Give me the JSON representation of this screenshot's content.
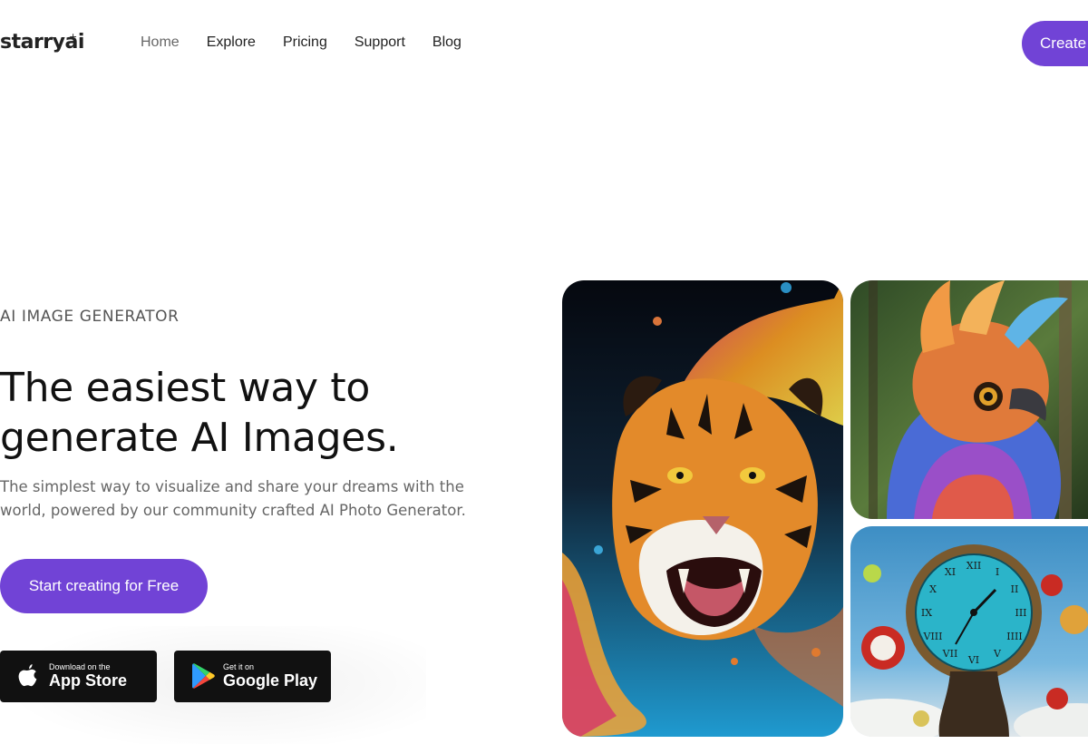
{
  "brand": {
    "logo_text": "starryai",
    "logo_star": "+",
    "accent_color": "#7143d6"
  },
  "nav": {
    "items": [
      {
        "label": "Home",
        "active": true
      },
      {
        "label": "Explore"
      },
      {
        "label": "Pricing"
      },
      {
        "label": "Support"
      },
      {
        "label": "Blog"
      }
    ],
    "create_label": "Create"
  },
  "hero": {
    "eyebrow": "AI IMAGE GENERATOR",
    "headline": "The easiest way to generate AI Images.",
    "subtitle": "The simplest way to visualize and share your dreams with the world, powered by our community crafted AI Photo Generator.",
    "cta_label": "Start creating for Free"
  },
  "stores": {
    "apple": {
      "small": "Download on the",
      "big": "App Store",
      "icon": "apple-logo-icon"
    },
    "google": {
      "small": "Get it on",
      "big": "Google Play",
      "icon": "google-play-logo-icon"
    }
  },
  "gallery": [
    {
      "subject": "tiger-image"
    },
    {
      "subject": "bird-image"
    },
    {
      "subject": "clock-image"
    }
  ]
}
